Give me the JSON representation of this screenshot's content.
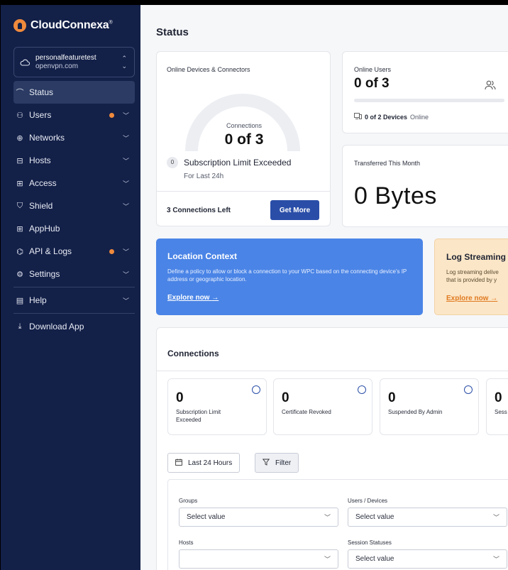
{
  "brand": {
    "name": "CloudConnexa",
    "mark": "®"
  },
  "tenant": {
    "name": "personalfeaturetest",
    "domain": "openvpn.com"
  },
  "sidebar": {
    "items": [
      {
        "label": "Status",
        "icon": "chart-line-icon",
        "glyph": "⌒"
      },
      {
        "label": "Users",
        "icon": "users-icon",
        "glyph": "⚇"
      },
      {
        "label": "Networks",
        "icon": "globe-icon",
        "glyph": "⊕"
      },
      {
        "label": "Hosts",
        "icon": "server-icon",
        "glyph": "⊟"
      },
      {
        "label": "Access",
        "icon": "grid-icon",
        "glyph": "⊞"
      },
      {
        "label": "Shield",
        "icon": "shield-icon",
        "glyph": "⛉"
      },
      {
        "label": "AppHub",
        "icon": "apps-icon",
        "glyph": "⊞"
      },
      {
        "label": "API & Logs",
        "icon": "api-icon",
        "glyph": "⌬"
      },
      {
        "label": "Settings",
        "icon": "gear-icon",
        "glyph": "⚙"
      },
      {
        "label": "Help",
        "icon": "book-icon",
        "glyph": "▤"
      },
      {
        "label": "Download App",
        "icon": "download-icon",
        "glyph": "⤓"
      }
    ]
  },
  "page": {
    "title": "Status"
  },
  "devices": {
    "label": "Online Devices & Connectors",
    "gauge_label": "Connections",
    "gauge_value": "0 of 3",
    "gauge_fraction": 0,
    "limit_count": "0",
    "limit_text": "Subscription Limit Exceeded",
    "limit_sub": "For Last 24h",
    "left_text": "3 Connections Left",
    "button": "Get More"
  },
  "users": {
    "label": "Online Users",
    "value": "0 of 3",
    "progress": 0,
    "devices_strong": "0 of 2 Devices",
    "devices_rest": "Online"
  },
  "transfer": {
    "label": "Transferred This Month",
    "value": "0 Bytes"
  },
  "promo_location": {
    "title": "Location Context",
    "desc": "Define a policy to allow or block a connection to your WPC based on the connecting device's IP address or geographic location.",
    "link": "Explore now",
    "arrow": "→"
  },
  "promo_stream": {
    "title": "Log Streaming",
    "desc_1": "Log streaming delive",
    "desc_2": "that is provided by y",
    "link": "Explore now",
    "arrow": "→"
  },
  "connections": {
    "title": "Connections",
    "stats": [
      {
        "value": "0",
        "label": "Subscription Limit Exceeded"
      },
      {
        "value": "0",
        "label": "Certificate Revoked"
      },
      {
        "value": "0",
        "label": "Suspended By Admin"
      },
      {
        "value": "0",
        "label": "Sess"
      }
    ],
    "date_button": "Last 24 Hours",
    "filter_button": "Filter",
    "filters": {
      "groups_label": "Groups",
      "groups_value": "Select value",
      "users_label": "Users / Devices",
      "users_value": "Select value",
      "hosts_label": "Hosts",
      "hosts_value": "",
      "status_label": "Session Statuses",
      "status_value": "Select value"
    }
  },
  "colors": {
    "sidebar": "#132048",
    "primary": "#2a4ea8",
    "accent": "#f08a3c",
    "promo_blue": "#4a84e6",
    "promo_orange": "#fbe6c7"
  }
}
